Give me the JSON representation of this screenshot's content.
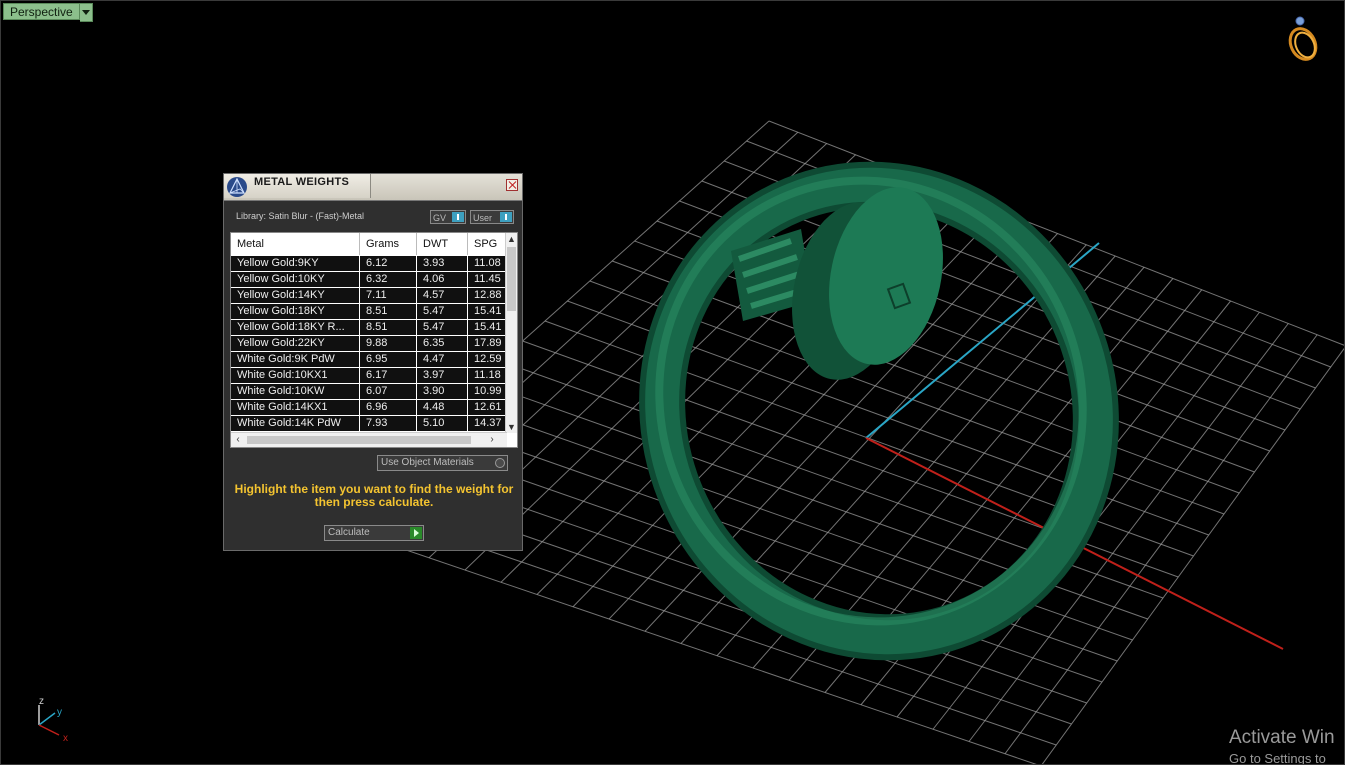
{
  "viewport": {
    "view_label": "Perspective",
    "watermark_title": "Activate Win",
    "watermark_sub": "Go to Settings to",
    "axes": {
      "z": "z",
      "y": "y",
      "x": "x"
    }
  },
  "panel": {
    "title": "METAL WEIGHTS",
    "library_label": "Library: Satin Blur - (Fast)-Metal",
    "toggle_gv": "GV",
    "toggle_user": "User",
    "columns": [
      "Metal",
      "Grams",
      "DWT",
      "SPG"
    ],
    "rows": [
      {
        "metal": "Yellow Gold:9KY",
        "grams": "6.12",
        "dwt": "3.93",
        "spg": "11.08"
      },
      {
        "metal": "Yellow Gold:10KY",
        "grams": "6.32",
        "dwt": "4.06",
        "spg": "11.45"
      },
      {
        "metal": "Yellow Gold:14KY",
        "grams": "7.11",
        "dwt": "4.57",
        "spg": "12.88"
      },
      {
        "metal": "Yellow Gold:18KY",
        "grams": "8.51",
        "dwt": "5.47",
        "spg": "15.41"
      },
      {
        "metal": "Yellow Gold:18KY R...",
        "grams": "8.51",
        "dwt": "5.47",
        "spg": "15.41"
      },
      {
        "metal": "Yellow Gold:22KY",
        "grams": "9.88",
        "dwt": "6.35",
        "spg": "17.89"
      },
      {
        "metal": "White Gold:9K PdW",
        "grams": "6.95",
        "dwt": "4.47",
        "spg": "12.59"
      },
      {
        "metal": "White Gold:10KX1",
        "grams": "6.17",
        "dwt": "3.97",
        "spg": "11.18"
      },
      {
        "metal": "White Gold:10KW",
        "grams": "6.07",
        "dwt": "3.90",
        "spg": "10.99"
      },
      {
        "metal": "White Gold:14KX1",
        "grams": "6.96",
        "dwt": "4.48",
        "spg": "12.61"
      },
      {
        "metal": "White Gold:14K PdW",
        "grams": "7.93",
        "dwt": "5.10",
        "spg": "14.37"
      }
    ],
    "use_object_materials": "Use Object Materials",
    "hint": "Highlight the item you want to find the weight for then press calculate.",
    "calculate_label": "Calculate"
  }
}
